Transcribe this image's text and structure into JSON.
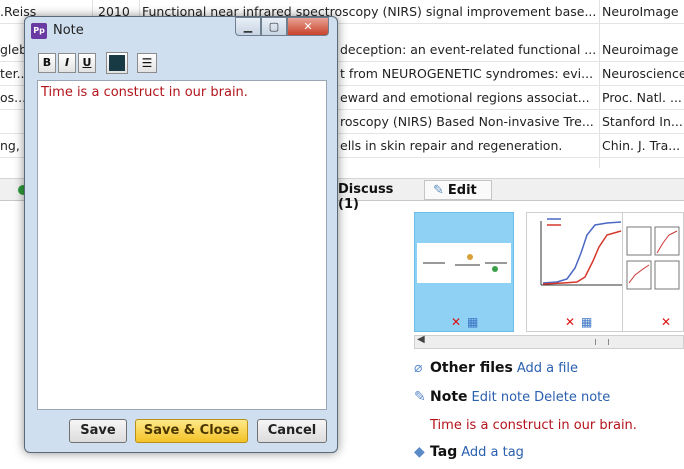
{
  "table": {
    "rows": [
      {
        "author": ".Reiss",
        "year": "2010",
        "title": "Functional near infrared spectroscopy (NIRS) signal improvement base...",
        "journal": "NeuroImage"
      },
      {
        "author": "gleb",
        "year": "",
        "title": "deception: an event-related functional ...",
        "journal": "Neuroimage"
      },
      {
        "author": "ter...",
        "year": "",
        "title": "t from NEUROGENETIC syndromes: evi...",
        "journal": "Neuroscience"
      },
      {
        "author": "os...",
        "year": "",
        "title": "eward and emotional regions associat...",
        "journal": "Proc. Natl. ..."
      },
      {
        "author": "",
        "year": "",
        "title": "roscopy (NIRS) Based Non-invasive Tre...",
        "journal": "Stanford In..."
      },
      {
        "author": "ng, F",
        "year": "",
        "title": "ells in skin repair and regeneration.",
        "journal": "Chin. J. Tra..."
      }
    ]
  },
  "tabs": {
    "discuss": "Discuss (1)",
    "edit": "Edit"
  },
  "info": {
    "other_files": "Other files",
    "add_file": "Add a file",
    "note": "Note",
    "edit_note": "Edit note",
    "delete_note": "Delete note",
    "note_text": "Time is a construct in our brain.",
    "tag": "Tag",
    "add_tag": "Add a tag"
  },
  "dialog": {
    "title": "Note",
    "app_icon_text": "Pp",
    "toolbar": {
      "bold": "B",
      "italic": "I",
      "underline": "U"
    },
    "swatch_color": "#173a45",
    "content": "Time is a construct in our brain.",
    "buttons": {
      "save": "Save",
      "save_close": "Save & Close",
      "cancel": "Cancel"
    }
  },
  "colors": {
    "note_red": "#b3141c",
    "link_blue": "#2a5fae",
    "primary_button": "#f3c227"
  }
}
